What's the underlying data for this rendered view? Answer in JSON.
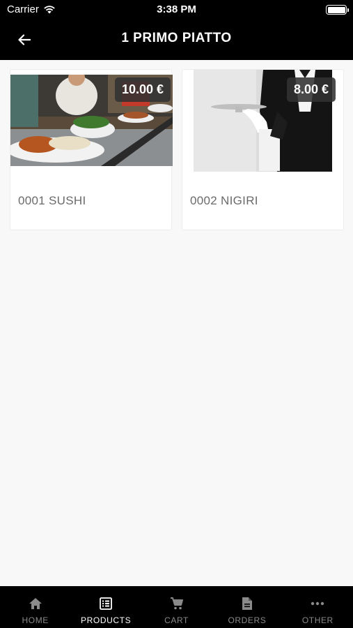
{
  "status_bar": {
    "carrier": "Carrier",
    "time": "3:38 PM"
  },
  "header": {
    "title": "1 PRIMO PIATTO",
    "back_icon": "arrow-left-icon"
  },
  "products": [
    {
      "name": "0001 SUSHI",
      "price": "10.00 €"
    },
    {
      "name": "0002 NIGIRI",
      "price": "8.00 €"
    }
  ],
  "tabs": [
    {
      "label": "HOME",
      "icon": "home-icon",
      "active": false
    },
    {
      "label": "PRODUCTS",
      "icon": "list-icon",
      "active": true
    },
    {
      "label": "CART",
      "icon": "cart-icon",
      "active": false
    },
    {
      "label": "ORDERS",
      "icon": "document-icon",
      "active": false
    },
    {
      "label": "OTHER",
      "icon": "more-icon",
      "active": false
    }
  ],
  "colors": {
    "bar": "#000000",
    "background": "#f8f8f8",
    "active_tab": "#ffffff",
    "inactive_tab": "#8a8a8a"
  }
}
